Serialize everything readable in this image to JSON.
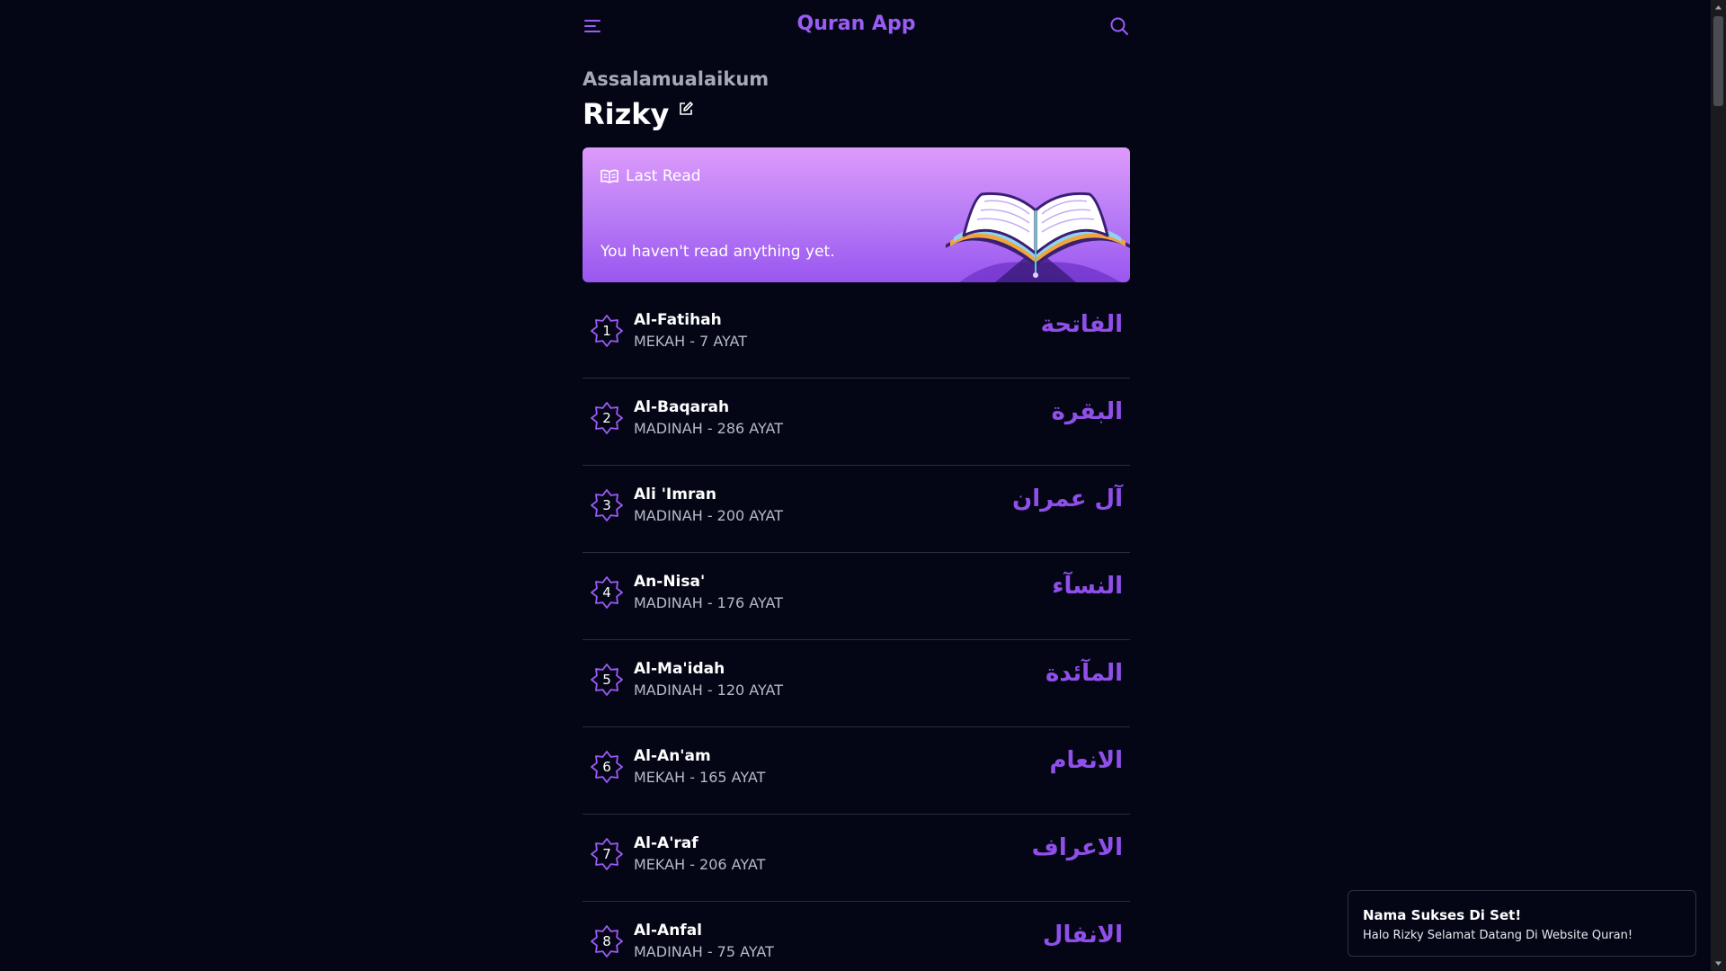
{
  "header": {
    "title": "Quran App",
    "menu_icon": "menu-icon",
    "search_icon": "search-icon"
  },
  "greeting": {
    "salutation": "Assalamualaikum",
    "user_name": "Rizky",
    "edit_icon": "edit-icon"
  },
  "last_read": {
    "label": "Last Read",
    "message": "You haven't read anything yet.",
    "icon": "book-open-icon"
  },
  "surahs": [
    {
      "number": "1",
      "name": "Al-Fatihah",
      "meta": "MEKAH - 7 AYAT",
      "arabic": "الفاتحة"
    },
    {
      "number": "2",
      "name": "Al-Baqarah",
      "meta": "MADINAH - 286 AYAT",
      "arabic": "البقرة"
    },
    {
      "number": "3",
      "name": "Ali 'Imran",
      "meta": "MADINAH - 200 AYAT",
      "arabic": "آل عمران"
    },
    {
      "number": "4",
      "name": "An-Nisa'",
      "meta": "MADINAH - 176 AYAT",
      "arabic": "النسآء"
    },
    {
      "number": "5",
      "name": "Al-Ma'idah",
      "meta": "MADINAH - 120 AYAT",
      "arabic": "المآئدة"
    },
    {
      "number": "6",
      "name": "Al-An'am",
      "meta": "MEKAH - 165 AYAT",
      "arabic": "الانعام"
    },
    {
      "number": "7",
      "name": "Al-A'raf",
      "meta": "MEKAH - 206 AYAT",
      "arabic": "الاعراف"
    },
    {
      "number": "8",
      "name": "Al-Anfal",
      "meta": "MADINAH - 75 AYAT",
      "arabic": "الانفال"
    }
  ],
  "toast": {
    "title": "Nama Sukses Di Set!",
    "message": "Halo Rizky Selamat Datang Di Website Quran!"
  },
  "colors": {
    "background": "#040616",
    "accent": "#9b5cf6",
    "arabic": "#8f4fe8",
    "card_gradient_top": "#dd9bfb",
    "card_gradient_bottom": "#9a56f0"
  }
}
